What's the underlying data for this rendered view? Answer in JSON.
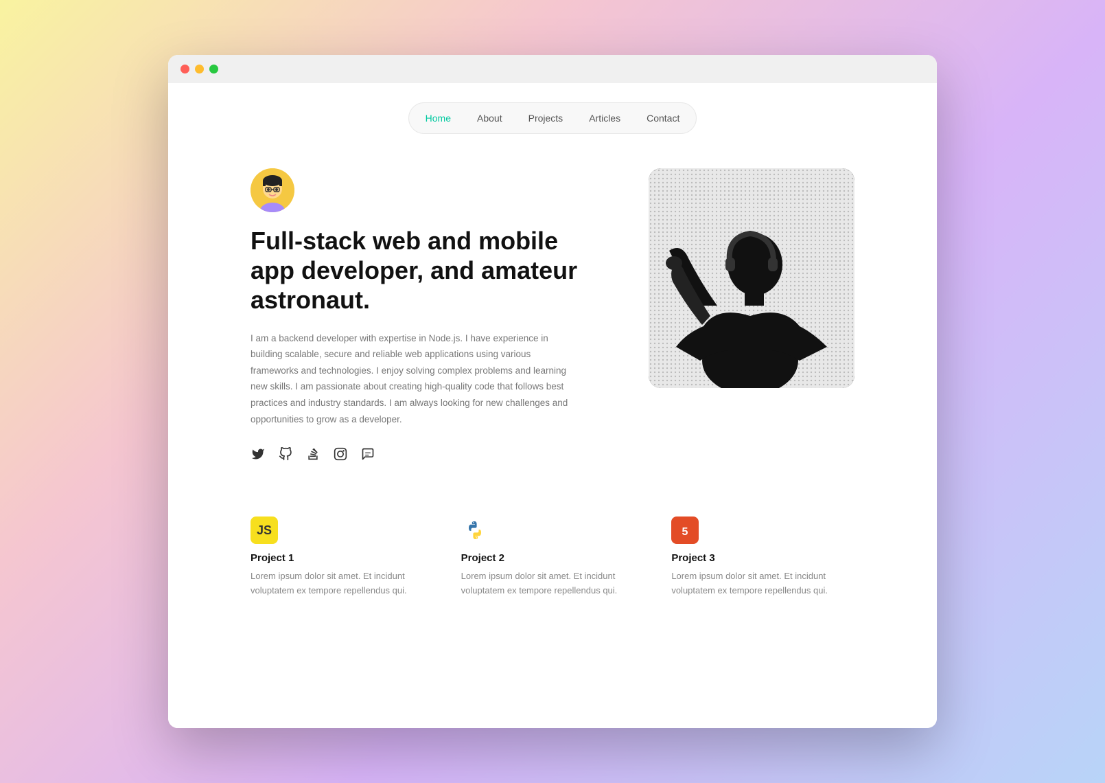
{
  "browser": {
    "dots": [
      "red",
      "yellow",
      "green"
    ]
  },
  "nav": {
    "items": [
      {
        "label": "Home",
        "active": true
      },
      {
        "label": "About",
        "active": false
      },
      {
        "label": "Projects",
        "active": false
      },
      {
        "label": "Articles",
        "active": false
      },
      {
        "label": "Contact",
        "active": false
      }
    ]
  },
  "hero": {
    "title": "Full-stack web and mobile app developer, and amateur astronaut.",
    "description": "I am a backend developer with expertise in Node.js. I have experience in building scalable, secure and reliable web applications using various frameworks and technologies. I enjoy solving complex problems and learning new skills. I am passionate about creating high-quality code that follows best practices and industry standards. I am always looking for new challenges and opportunities to grow as a developer.",
    "social_links": [
      {
        "name": "twitter",
        "label": "Twitter"
      },
      {
        "name": "github",
        "label": "GitHub"
      },
      {
        "name": "stackoverflow",
        "label": "Stack Overflow"
      },
      {
        "name": "instagram",
        "label": "Instagram"
      },
      {
        "name": "chat",
        "label": "Chat"
      }
    ]
  },
  "projects": [
    {
      "icon_type": "js",
      "icon_label": "JS",
      "title": "Project 1",
      "description": "Lorem ipsum dolor sit amet. Et incidunt voluptatem ex tempore repellendus qui."
    },
    {
      "icon_type": "python",
      "icon_label": "🐍",
      "title": "Project 2",
      "description": "Lorem ipsum dolor sit amet. Et incidunt voluptatem ex tempore repellendus qui."
    },
    {
      "icon_type": "html",
      "icon_label": "5",
      "title": "Project 3",
      "description": "Lorem ipsum dolor sit amet. Et incidunt voluptatem ex tempore repellendus qui."
    }
  ]
}
